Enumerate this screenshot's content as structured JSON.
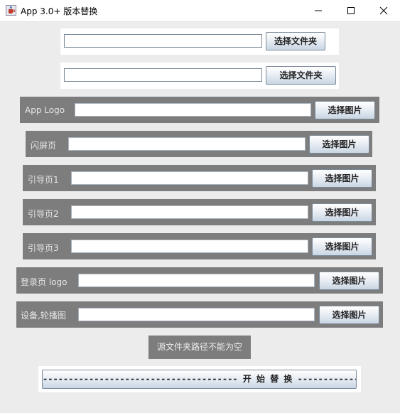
{
  "window": {
    "title": "App 3.0+ 版本替换",
    "icon": "java-cup-icon"
  },
  "rows": [
    {
      "label": "",
      "button": "选择文件夹",
      "value": ""
    },
    {
      "label": "",
      "button": "选择文件夹",
      "value": ""
    },
    {
      "label": "App Logo",
      "button": "选择图片",
      "value": ""
    },
    {
      "label": "闪屏页",
      "button": "选择图片",
      "value": ""
    },
    {
      "label": "引导页1",
      "button": "选择图片",
      "value": ""
    },
    {
      "label": "引导页2",
      "button": "选择图片",
      "value": ""
    },
    {
      "label": "引导页3",
      "button": "选择图片",
      "value": ""
    },
    {
      "label": "登录页 logo",
      "button": "选择图片",
      "value": ""
    },
    {
      "label": "设备,轮播图",
      "button": "选择图片",
      "value": ""
    }
  ],
  "status": "源文件夹路径不能为空",
  "start_button": "-------------------------------------- 开 始 替 换 --------------------------------------",
  "colors": {
    "panel": "#7d7d7d",
    "background": "#ececec",
    "button_top": "#ffffff",
    "button_bottom": "#c9d6e4"
  }
}
